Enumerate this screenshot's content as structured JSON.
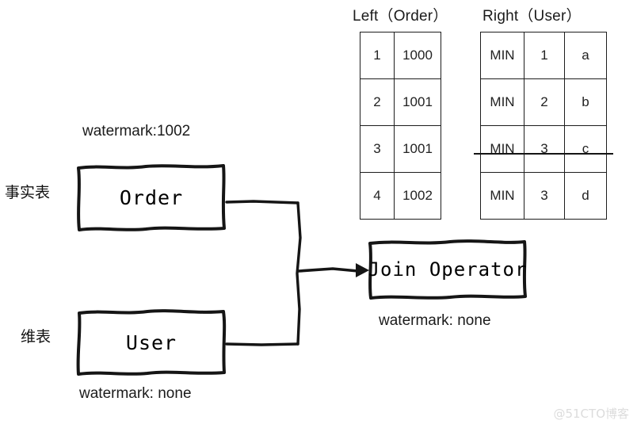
{
  "tables": {
    "left": {
      "title": "Left（Order）",
      "rows": [
        [
          "1",
          "1000"
        ],
        [
          "2",
          "1001"
        ],
        [
          "3",
          "1001"
        ],
        [
          "4",
          "1002"
        ]
      ]
    },
    "right": {
      "title": "Right（User）",
      "rows": [
        [
          "MIN",
          "1",
          "a"
        ],
        [
          "MIN",
          "2",
          "b"
        ],
        [
          "MIN",
          "3",
          "c"
        ],
        [
          "MIN",
          "3",
          "d"
        ]
      ],
      "struck_row_index": 2
    }
  },
  "nodes": {
    "order": {
      "label": "Order",
      "side_label": "事实表",
      "watermark": "watermark:1002"
    },
    "user": {
      "label": "User",
      "side_label": "维表",
      "watermark": "watermark: none"
    },
    "join": {
      "label": "Join Operator",
      "watermark": "watermark: none"
    }
  },
  "footer": {
    "watermark": "@51CTO博客"
  },
  "colors": {
    "stroke": "#151515",
    "text": "#111111",
    "footer_watermark": "#dcdcdc",
    "background": "#ffffff"
  }
}
